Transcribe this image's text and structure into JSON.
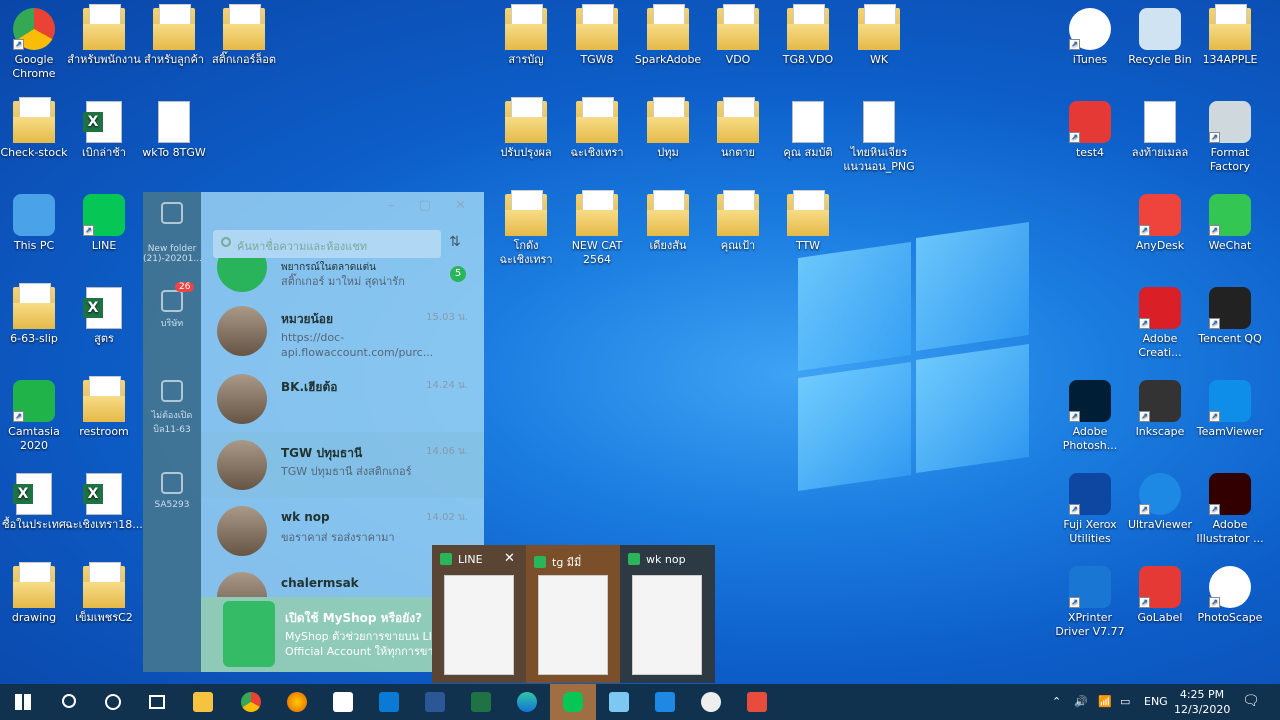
{
  "desktop_icons": [
    {
      "label": "Google Chrome",
      "type": "chrome"
    },
    {
      "label": "สำหรับพนักงาน",
      "type": "folder"
    },
    {
      "label": "สำหรับลูกค้า",
      "type": "folder"
    },
    {
      "label": "สติ๊กเกอร์ล็อต",
      "type": "folder"
    },
    {
      "label": "Check-stock",
      "type": "folder"
    },
    {
      "label": "เบิกล่าช้า",
      "type": "excel"
    },
    {
      "label": "wkTo 8TGW",
      "type": "doc"
    },
    {
      "label": "This PC",
      "type": "pc"
    },
    {
      "label": "LINE",
      "type": "line"
    },
    {
      "label": "6-63-slip",
      "type": "folder"
    },
    {
      "label": "สูตร",
      "type": "excel"
    },
    {
      "label": "Camtasia 2020",
      "type": "camtasia"
    },
    {
      "label": "restroom",
      "type": "folder"
    },
    {
      "label": "ซื้อในประเทศ",
      "type": "excel"
    },
    {
      "label": "ฉะเชิงเทรา18...",
      "type": "excel"
    },
    {
      "label": "drawing",
      "type": "folder"
    },
    {
      "label": "เข็มเพชรC2",
      "type": "folder"
    },
    {
      "label": "สารบัญ",
      "type": "folder"
    },
    {
      "label": "TGW8",
      "type": "folder"
    },
    {
      "label": "SparkAdobe",
      "type": "folder"
    },
    {
      "label": "VDO",
      "type": "folder"
    },
    {
      "label": "TG8.VDO",
      "type": "folder"
    },
    {
      "label": "WK",
      "type": "folder"
    },
    {
      "label": "ปรับปรุงผล",
      "type": "folder"
    },
    {
      "label": "ฉะเชิงเทรา",
      "type": "folder"
    },
    {
      "label": "ปทุม",
      "type": "folder"
    },
    {
      "label": "นกตาย",
      "type": "folder"
    },
    {
      "label": "คุณ สมบัติ",
      "type": "doc"
    },
    {
      "label": "ไทยหินเจียร แนวนอน_PNG",
      "type": "doc"
    },
    {
      "label": "โกดังฉะเชิงเทรา",
      "type": "folder"
    },
    {
      "label": "NEW CAT 2564",
      "type": "folder"
    },
    {
      "label": "เดียงสัน",
      "type": "folder"
    },
    {
      "label": "คุณเป้า",
      "type": "folder"
    },
    {
      "label": "TTW",
      "type": "folder"
    },
    {
      "label": "iTunes",
      "type": "itunes"
    },
    {
      "label": "Recycle Bin",
      "type": "bin"
    },
    {
      "label": "134APPLE",
      "type": "folder"
    },
    {
      "label": "test4",
      "type": "go"
    },
    {
      "label": "ลงท้ายเมลล",
      "type": "doc"
    },
    {
      "label": "Format Factory",
      "type": "ff"
    },
    {
      "label": "AnyDesk",
      "type": "anydesk"
    },
    {
      "label": "WeChat",
      "type": "wechat"
    },
    {
      "label": "Adobe Creati...",
      "type": "acc"
    },
    {
      "label": "Tencent QQ",
      "type": "qq"
    },
    {
      "label": "Adobe Photosh...",
      "type": "ps"
    },
    {
      "label": "Inkscape",
      "type": "inkscape"
    },
    {
      "label": "TeamViewer",
      "type": "tv"
    },
    {
      "label": "Fuji Xerox Utilities",
      "type": "fuji"
    },
    {
      "label": "UltraViewer",
      "type": "uv"
    },
    {
      "label": "Adobe Illustrator ...",
      "type": "ai"
    },
    {
      "label": "XPrinter Driver V7.77",
      "type": "xp"
    },
    {
      "label": "GoLabel",
      "type": "go"
    },
    {
      "label": "PhotoScape",
      "type": "photoscape"
    }
  ],
  "line_window": {
    "search_placeholder": "ค้นหาชื่อความและห้องแชท",
    "side_labels": [
      "New folder (21)-20201...",
      "บริษัท",
      "ไม่ต้องเปิดบิล11-63",
      "SA5293"
    ],
    "side_badge": "26",
    "top_partial": {
      "name": "พยากรณ์ในตลาดแต่น",
      "msg": "สติ๊กเกอร์ มาใหม่ สุดน่ารัก",
      "badge": "5"
    },
    "chats": [
      {
        "name": "หมวยน้อย",
        "msg": "https://doc-api.flowaccount.com/purc...",
        "time": "15.03 น."
      },
      {
        "name": "BK.เฮียต้อ",
        "msg": "",
        "time": "14.24 น."
      },
      {
        "name": "TGW ปทุมธานี",
        "msg": "TGW ปทุมธานี ส่งสติกเกอร์",
        "time": "14.06 น."
      },
      {
        "name": "wk nop",
        "msg": "ขอราคาส่ รอส่งราคามา",
        "time": "14.02 น."
      },
      {
        "name": "chalermsak",
        "msg": "",
        "time": ""
      }
    ],
    "promo_title": "เปิดใช้ MyShop หรือยัง?",
    "promo_text": "MyShop ตัวช่วยการขายบน LINE Official Account ให้ทุกการขาย"
  },
  "thumbnails": [
    {
      "title": "LINE",
      "close": "✕"
    },
    {
      "title": "tg มีมี่",
      "close": ""
    },
    {
      "title": "wk nop",
      "close": ""
    }
  ],
  "tray": {
    "lang": "ENG",
    "time": "4:25 PM",
    "date": "12/3/2020"
  }
}
